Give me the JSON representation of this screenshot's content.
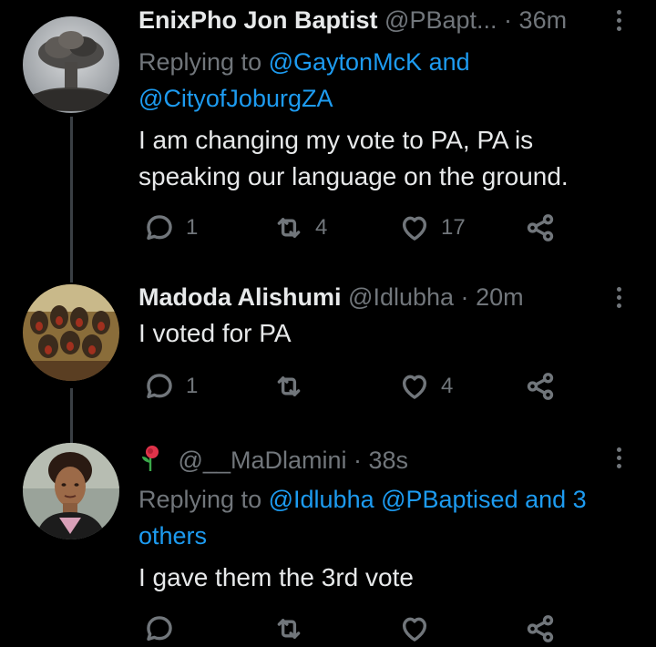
{
  "tweets": [
    {
      "display_name": "EnixPho Jon Baptist",
      "handle": "@PBapt...",
      "sep": "·",
      "time": "36m",
      "replying_prefix": "Replying to",
      "replying_line1": "@GaytonMcK and",
      "replying_line2": "@CityofJoburgZA",
      "text": "I am changing my vote to PA, PA is speaking our language on the ground.",
      "replies": "1",
      "retweets": "4",
      "likes": "17"
    },
    {
      "display_name": "Madoda Alishumi",
      "handle": "@Idlubha",
      "sep": "·",
      "time": "20m",
      "text": "I voted for PA",
      "replies": "1",
      "retweets": "",
      "likes": "4"
    },
    {
      "display_name": "",
      "handle": "@__MaDlamini",
      "sep": "·",
      "time": "38s",
      "replying_prefix": "Replying to",
      "replying_mentions": "@Idlubha @PBaptised and 3 others",
      "text": "I gave them the 3rd vote",
      "replies": "",
      "retweets": "",
      "likes": ""
    }
  ],
  "icons": {
    "reply": "reply-icon",
    "retweet": "retweet-icon",
    "like": "heart-icon",
    "share": "share-icon",
    "more": "more-vertical-icon",
    "name_emoji": "rose-emoji-icon"
  },
  "colors": {
    "background": "#000000",
    "text": "#e7e9ea",
    "muted": "#71767b",
    "link": "#1d9bf0"
  }
}
